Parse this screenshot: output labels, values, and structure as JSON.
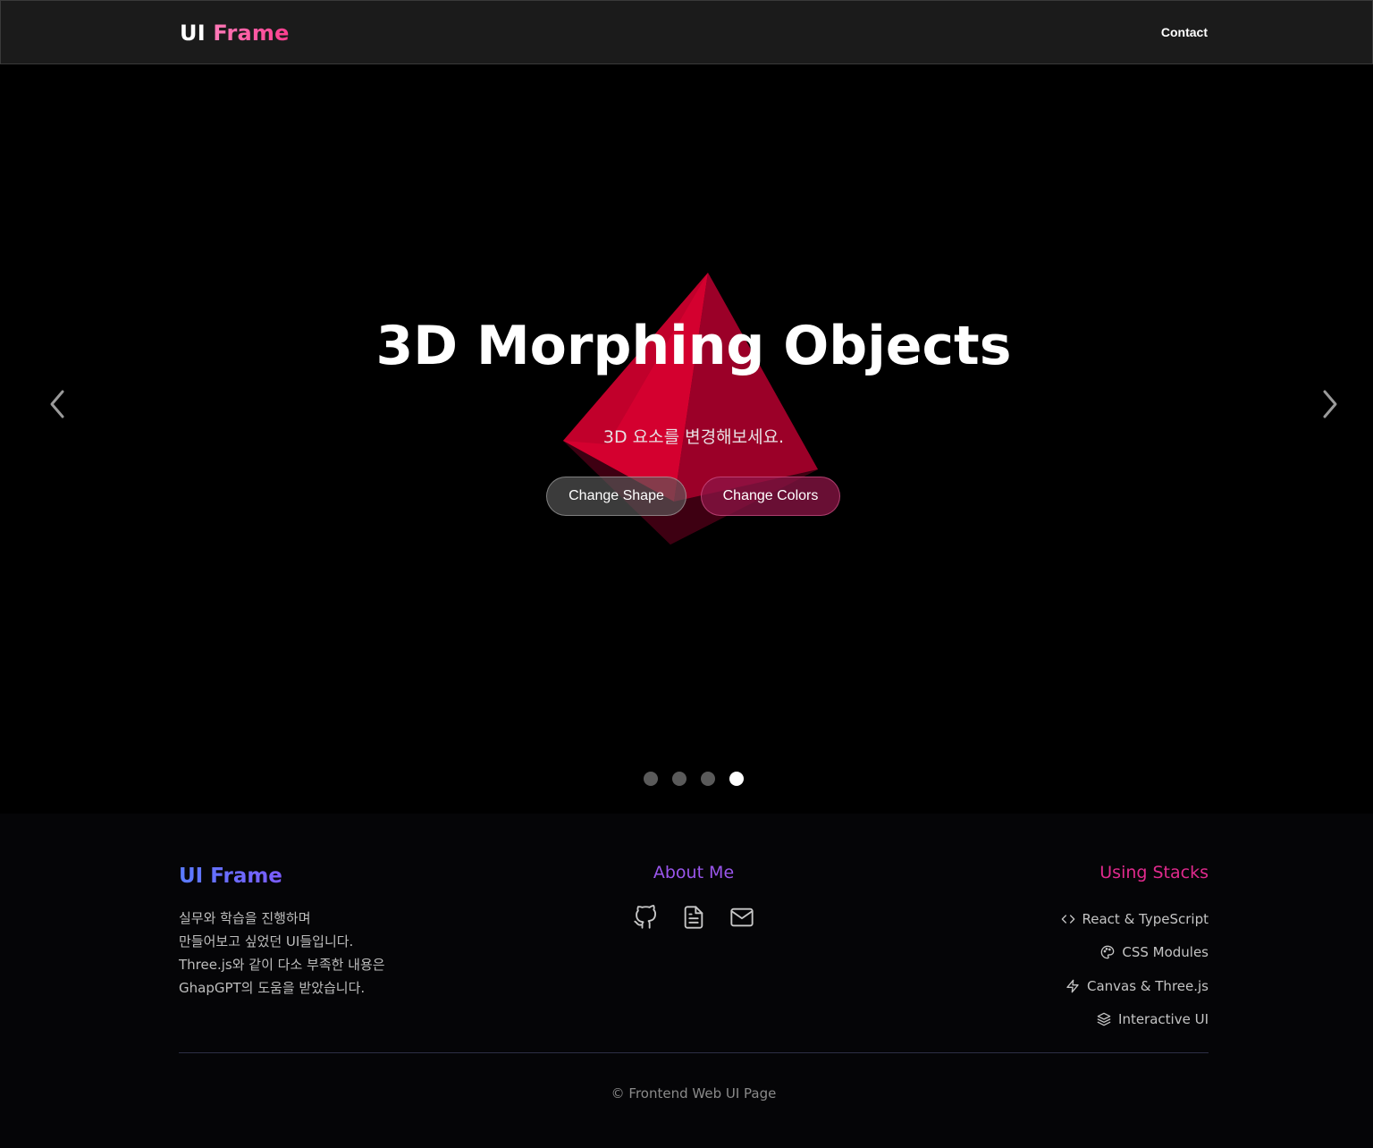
{
  "header": {
    "logo_part1": "UI",
    "logo_part2": "Frame",
    "nav_contact": "Contact"
  },
  "hero": {
    "title": "3D Morphing Objects",
    "subtitle": "3D 요소를 변경해보세요.",
    "buttons": {
      "change_shape": "Change Shape",
      "change_colors": "Change Colors"
    },
    "slides": {
      "total": 4,
      "active": 4
    }
  },
  "footer": {
    "brand": "UI Frame",
    "description": [
      "실무와 학습을 진행하며",
      "만들어보고 싶었던 UI들입니다.",
      "Three.js와 같이 다소 부족한 내용은",
      "GhapGPT의 도움을 받았습니다."
    ],
    "about_title": "About Me",
    "about_icons": [
      "github-icon",
      "document-icon",
      "mail-icon"
    ],
    "stacks_title": "Using Stacks",
    "stacks": [
      {
        "icon": "code-icon",
        "label": "React & TypeScript"
      },
      {
        "icon": "palette-icon",
        "label": "CSS Modules"
      },
      {
        "icon": "lightning-icon",
        "label": "Canvas & Three.js"
      },
      {
        "icon": "layers-icon",
        "label": "Interactive UI"
      }
    ],
    "copyright": "© Frontend Web UI Page"
  },
  "colors": {
    "header_bg": "#1b1b1b",
    "accent_pink": "#ff3d8f",
    "cube_red": "#c8002e",
    "about_purple": "#9a56ec",
    "stacks_pink": "#e02a8d",
    "brand_blue": "#5a7bff"
  }
}
